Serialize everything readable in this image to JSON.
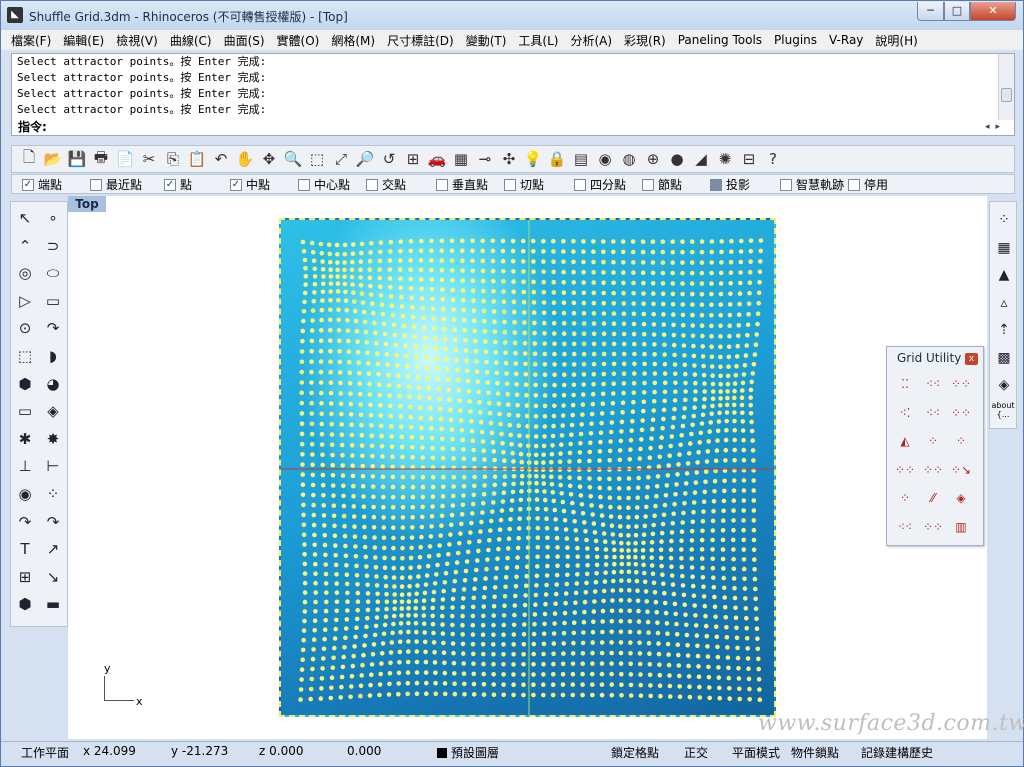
{
  "window": {
    "title": "Shuffle Grid.3dm - Rhinoceros (不可轉售授權版) - [Top]",
    "minimize": "─",
    "maximize": "□",
    "close": "✕"
  },
  "menubar": [
    "檔案(F)",
    "編輯(E)",
    "檢視(V)",
    "曲線(C)",
    "曲面(S)",
    "實體(O)",
    "網格(M)",
    "尺寸標註(D)",
    "變動(T)",
    "工具(L)",
    "分析(A)",
    "彩現(R)",
    "Paneling Tools",
    "Plugins",
    "V-Ray",
    "說明(H)"
  ],
  "command_history": [
    "Select attractor points。按 Enter 完成:",
    "Select attractor points。按 Enter 完成:",
    "Select attractor points。按 Enter 完成:",
    "Select attractor points。按 Enter 完成:"
  ],
  "command": {
    "label": "指令:",
    "value": ""
  },
  "toolbar_icons": [
    "new-icon",
    "open-icon",
    "save-icon",
    "print-icon",
    "import-icon",
    "cut-icon",
    "copy-icon",
    "paste-icon",
    "undo-icon",
    "pan-icon",
    "rotate-view-icon",
    "zoom-icon",
    "zoom-window-icon",
    "zoom-extents-icon",
    "zoom-selected-icon",
    "undo-view-icon",
    "four-viewports-icon",
    "car-icon",
    "grid-icon",
    "cplane-icon",
    "osnap-icon",
    "light-icon",
    "lock-icon",
    "layer-icon",
    "color-icon",
    "wireframe-icon",
    "shaded-icon",
    "render-icon",
    "material-icon",
    "options-icon",
    "properties-icon",
    "help-icon"
  ],
  "toolbar_glyphs": [
    "🗋",
    "📂",
    "💾",
    "🖶",
    "📄",
    "✂",
    "⎘",
    "📋",
    "↶",
    "✋",
    "✥",
    "🔍",
    "⬚",
    "⤢",
    "🔎",
    "↺",
    "⊞",
    "🚗",
    "▦",
    "⊸",
    "✣",
    "💡",
    "🔒",
    "▤",
    "◉",
    "◍",
    "⊕",
    "●",
    "◢",
    "✺",
    "⊟",
    "?"
  ],
  "osnap": [
    {
      "label": "端點",
      "checked": true
    },
    {
      "label": "最近點",
      "checked": false
    },
    {
      "label": "點",
      "checked": true
    },
    {
      "label": "中點",
      "checked": true
    },
    {
      "label": "中心點",
      "checked": false
    },
    {
      "label": "交點",
      "checked": false
    },
    {
      "label": "垂直點",
      "checked": false
    },
    {
      "label": "切點",
      "checked": false
    },
    {
      "label": "四分點",
      "checked": false
    },
    {
      "label": "節點",
      "checked": false
    },
    {
      "label": "投影",
      "checked": false,
      "gray": true
    },
    {
      "label": "智慧軌跡",
      "checked": false
    },
    {
      "label": "停用",
      "checked": false
    }
  ],
  "left_palette": [
    "↖",
    "∘",
    "⌃",
    "⊃",
    "◎",
    "⬭",
    "▷",
    "▭",
    "⊙",
    "↷",
    "⬚",
    "◗",
    "⬢",
    "◕",
    "▭",
    "◈",
    "✱",
    "✸",
    "⊥",
    "⊢",
    "◉",
    "⁘",
    "↷",
    "↷",
    "T",
    "↗",
    "⊞",
    "↘",
    "⬢",
    "▬"
  ],
  "right_palette": [
    "⁘",
    "▦",
    "▲",
    "▵",
    "⇡",
    "▩",
    "◈"
  ],
  "right_about": "about\n{...",
  "viewport": {
    "tab": "Top",
    "axis_x": "x",
    "axis_y": "y"
  },
  "watermark": "www.surface3d.com.tw",
  "grid_utility": {
    "title": "Grid Utility",
    "close": "x",
    "icons": [
      "⁚⁚",
      "⁖⁖",
      "⁘⁘",
      "⁖⁚",
      "⁖⁖",
      "⁘⁘",
      "◭",
      "⁘",
      "⁘",
      "⁘⁘",
      "⁘⁘",
      "⁘↘",
      "⁘",
      "⁄⁄",
      "◈",
      "⁖⁖",
      "⁘⁘",
      "▥"
    ]
  },
  "status": {
    "cplane": "工作平面",
    "x": "x 24.099",
    "y": "y -21.273",
    "z": "z 0.000",
    "dist": "0.000",
    "layer": "預設圖層",
    "snap": "鎖定格點",
    "ortho": "正交",
    "planar": "平面模式",
    "osnap": "物件鎖點",
    "history": "記錄建構歷史"
  },
  "colors": {
    "accent": "#f6ee6a",
    "plane_blue": "#1d9ed6",
    "axis_red": "#c0392b",
    "axis_green": "#9be07a"
  }
}
